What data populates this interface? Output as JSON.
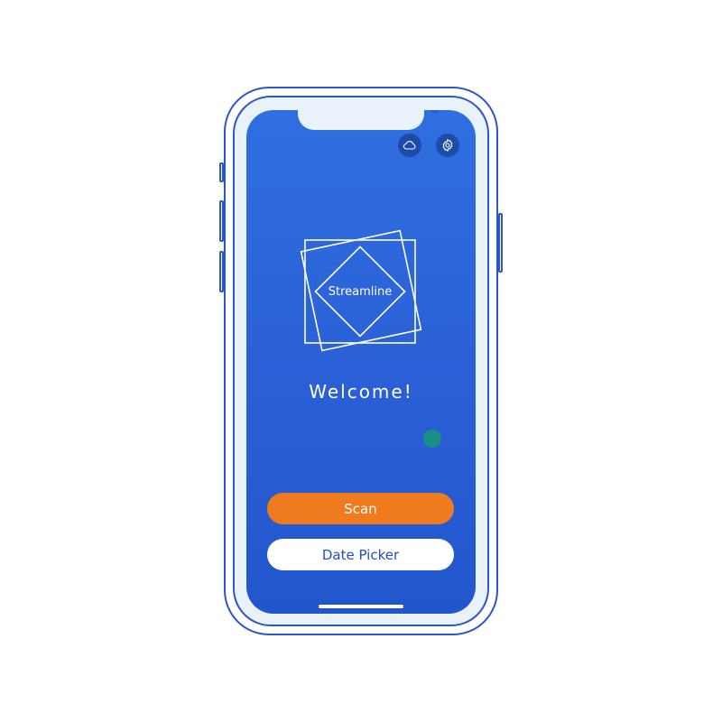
{
  "screen": {
    "brand_name": "Streamline",
    "welcome_text": "Welcome!",
    "top_icons": [
      "cloud-icon",
      "settings-gear-icon"
    ]
  },
  "actions": {
    "scan_label": "Scan",
    "date_picker_label": "Date Picker"
  },
  "colors": {
    "screen_background": "#2a63d8",
    "scan_button": "#f07a1e",
    "date_picker_button": "#ffffff",
    "date_picker_text": "#234fbf",
    "status_dot": "#1a8f86",
    "phone_outline": "#2c57c9"
  }
}
